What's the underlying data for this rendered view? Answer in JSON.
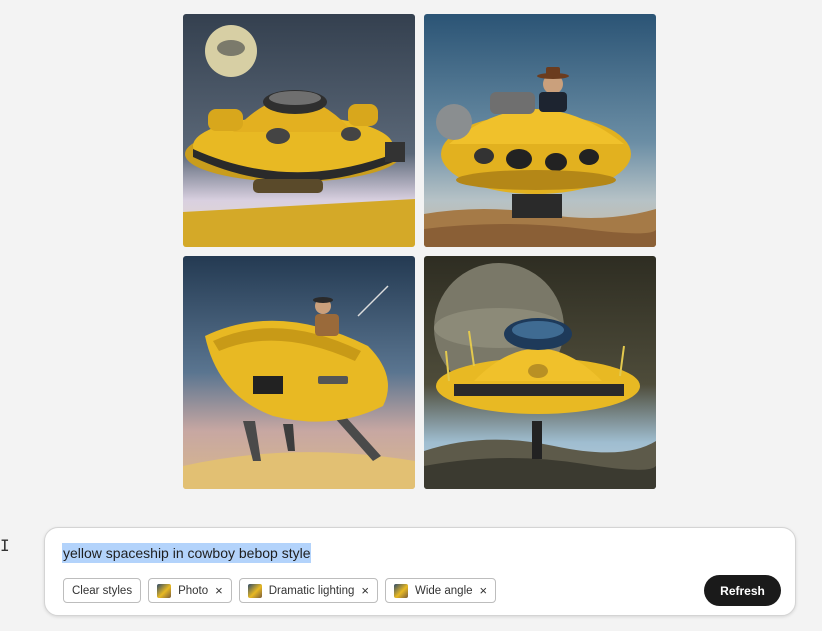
{
  "prompt": {
    "text": "yellow spaceship in cowboy bebop style"
  },
  "style_chips": [
    {
      "label": "Clear styles",
      "has_thumb": false,
      "removable": false
    },
    {
      "label": "Photo",
      "has_thumb": true,
      "removable": true,
      "remove_glyph": "×"
    },
    {
      "label": "Dramatic lighting",
      "has_thumb": true,
      "removable": true,
      "remove_glyph": "×"
    },
    {
      "label": "Wide angle",
      "has_thumb": true,
      "removable": true,
      "remove_glyph": "×"
    }
  ],
  "refresh_label": "Refresh",
  "cursor_glyph": "I",
  "colors": {
    "accent_yellow": "#e8b923",
    "button_dark": "#1a1a1a",
    "selection": "#b3d3fb",
    "background": "#f3f3f3"
  }
}
